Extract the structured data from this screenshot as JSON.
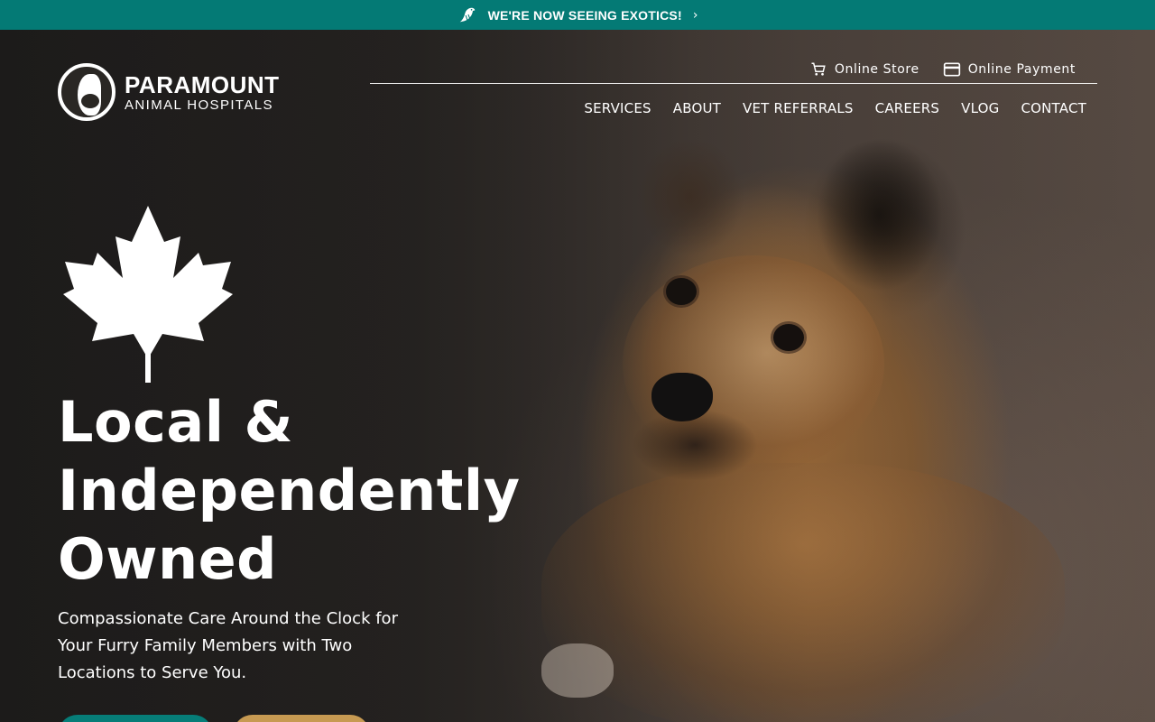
{
  "announcement": {
    "text": "WE'RE NOW SEEING EXOTICS!",
    "icon": "bird-icon",
    "chevron": "›"
  },
  "brand": {
    "line1": "PARAMOUNT",
    "line2": "ANIMAL HOSPITALS"
  },
  "utility": {
    "store_label": "Online Store",
    "payment_label": "Online Payment"
  },
  "nav": {
    "items": [
      "SERVICES",
      "ABOUT",
      "VET REFERRALS",
      "CAREERS",
      "VLOG",
      "CONTACT"
    ]
  },
  "hero": {
    "headline_lines": [
      "Local &",
      "Independently",
      "Owned"
    ],
    "subtext": "Compassionate Care Around the Clock for Your Furry Family Members with Two Locations to Serve You.",
    "button_primary": "",
    "button_secondary": ""
  },
  "colors": {
    "teal": "#047a75",
    "gold": "#c79a52",
    "text": "#ffffff"
  }
}
